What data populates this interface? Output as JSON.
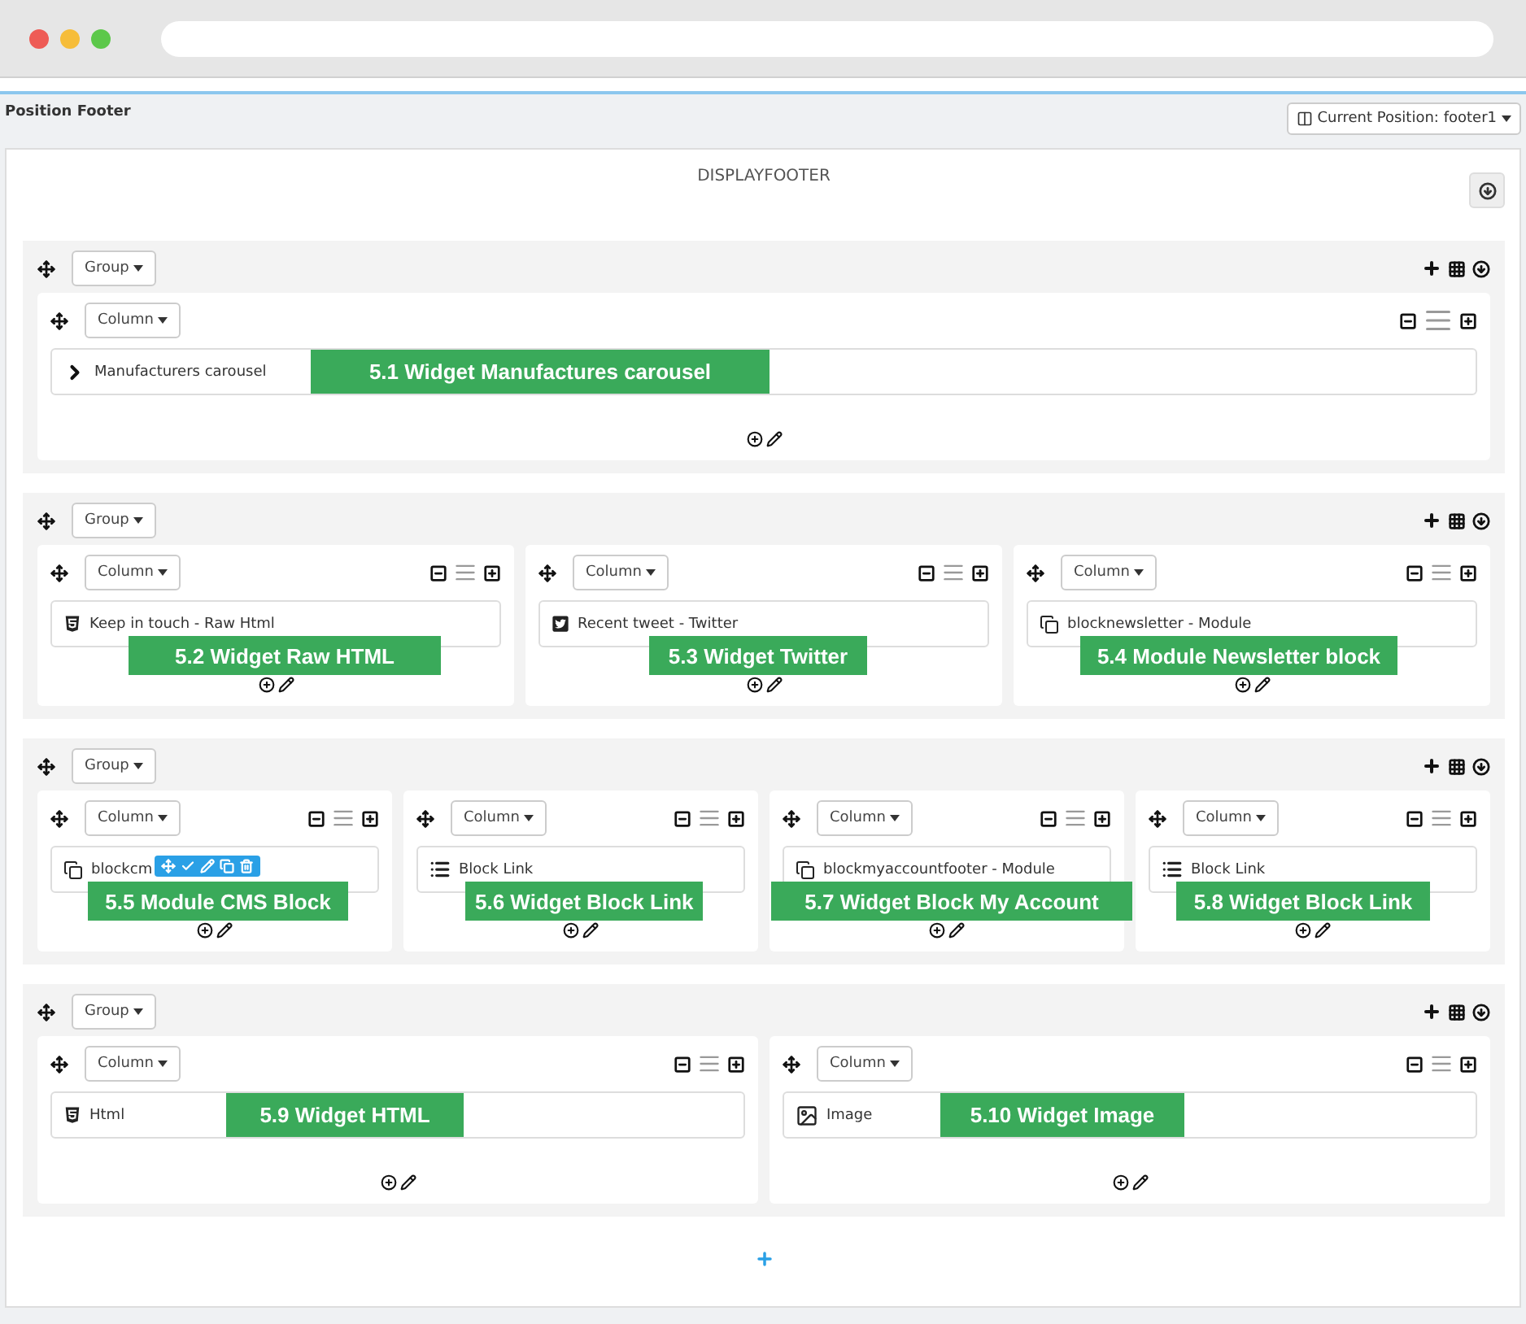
{
  "header": {
    "title": "Position Footer",
    "position_button": "Current Position: footer1"
  },
  "hook": {
    "title": "DISPLAYFOOTER"
  },
  "groups": [
    {
      "label": "Group",
      "columns": [
        {
          "label": "Column",
          "widget": {
            "kind": "chevron",
            "text": "Manufacturers carousel",
            "toolbar": false
          },
          "callout": "5.1 Widget Manufactures carousel"
        }
      ]
    },
    {
      "label": "Group",
      "columns": [
        {
          "label": "Column",
          "widget": {
            "kind": "html5",
            "text": "Keep in touch - Raw Html",
            "toolbar": false
          },
          "callout": "5.2 Widget Raw HTML"
        },
        {
          "label": "Column",
          "widget": {
            "kind": "twitter",
            "text": "Recent tweet - Twitter",
            "toolbar": false
          },
          "callout": "5.3 Widget Twitter"
        },
        {
          "label": "Column",
          "widget": {
            "kind": "module",
            "text": "blocknewsletter - Module",
            "toolbar": false
          },
          "callout": "5.4 Module Newsletter block"
        }
      ]
    },
    {
      "label": "Group",
      "columns": [
        {
          "label": "Column",
          "widget": {
            "kind": "module",
            "text": "blockcm",
            "toolbar": true
          },
          "callout": "5.5 Module CMS Block"
        },
        {
          "label": "Column",
          "widget": {
            "kind": "list",
            "text": "Block Link",
            "toolbar": false
          },
          "callout": "5.6 Widget Block Link"
        },
        {
          "label": "Column",
          "widget": {
            "kind": "module",
            "text": "blockmyaccountfooter - Module",
            "toolbar": false
          },
          "callout": "5.7 Widget Block My Account"
        },
        {
          "label": "Column",
          "widget": {
            "kind": "list",
            "text": "Block Link",
            "toolbar": false
          },
          "callout": "5.8 Widget Block Link"
        }
      ]
    },
    {
      "label": "Group",
      "columns": [
        {
          "label": "Column",
          "widget": {
            "kind": "html5",
            "text": "Html",
            "toolbar": false
          },
          "callout": "5.9 Widget HTML"
        },
        {
          "label": "Column",
          "widget": {
            "kind": "image",
            "text": "Image",
            "toolbar": false
          },
          "callout": "5.10 Widget Image"
        }
      ]
    }
  ]
}
